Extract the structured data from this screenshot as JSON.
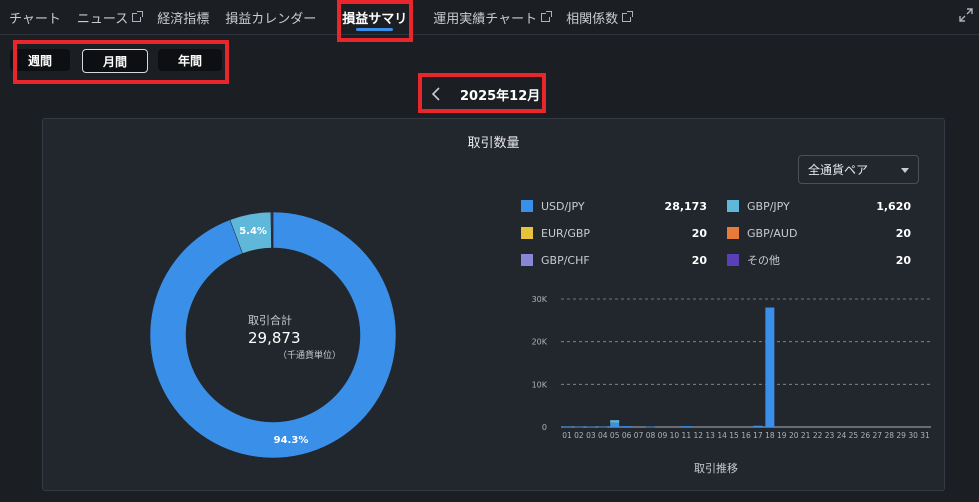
{
  "nav": {
    "tabs": [
      {
        "label": "チャート",
        "external": false
      },
      {
        "label": "ニュース",
        "external": true
      },
      {
        "label": "経済指標",
        "external": false
      },
      {
        "label": "損益カレンダー",
        "external": false
      },
      {
        "label": "損益サマリ",
        "external": false,
        "active": true
      },
      {
        "label": "運用実績チャート",
        "external": true
      },
      {
        "label": "相関係数",
        "external": true
      }
    ]
  },
  "period": {
    "options": [
      "週間",
      "月間",
      "年間"
    ],
    "selected": "月間"
  },
  "month_nav": {
    "label": "2025年12月"
  },
  "panel": {
    "title": "取引数量",
    "pair_select": "全通貨ペア",
    "chart_title": "取引推移"
  },
  "donut": {
    "center_label": "取引合計",
    "center_value": "29,873",
    "center_unit": "（千通貨単位）",
    "labels": [
      "94.3%",
      "5.4%"
    ]
  },
  "legend": [
    {
      "name": "USD/JPY",
      "value": "28,173",
      "color": "#3a8fe8"
    },
    {
      "name": "GBP/JPY",
      "value": "1,620",
      "color": "#5fb8d9"
    },
    {
      "name": "EUR/GBP",
      "value": "20",
      "color": "#e8c23a"
    },
    {
      "name": "GBP/AUD",
      "value": "20",
      "color": "#e87a3a"
    },
    {
      "name": "GBP/CHF",
      "value": "20",
      "color": "#8a86d6"
    },
    {
      "name": "その他",
      "value": "20",
      "color": "#5a3fb8"
    }
  ],
  "chart_data": [
    {
      "type": "pie",
      "categories": [
        "USD/JPY",
        "GBP/JPY",
        "EUR/GBP",
        "GBP/AUD",
        "GBP/CHF",
        "その他"
      ],
      "values": [
        28173,
        1620,
        20,
        20,
        20,
        20
      ],
      "labels": [
        "94.3%",
        "5.4%"
      ]
    },
    {
      "type": "bar",
      "title": "取引推移",
      "categories": [
        "01",
        "02",
        "03",
        "04",
        "05",
        "06",
        "07",
        "08",
        "09",
        "10",
        "11",
        "12",
        "13",
        "14",
        "15",
        "16",
        "17",
        "18",
        "19",
        "20",
        "21",
        "22",
        "23",
        "24",
        "25",
        "26",
        "27",
        "28",
        "29",
        "30",
        "31"
      ],
      "series": [
        {
          "values": [
            150,
            100,
            120,
            80,
            1000,
            200,
            0,
            100,
            0,
            0,
            200,
            0,
            0,
            0,
            0,
            0,
            300,
            28000,
            0,
            0,
            0,
            0,
            0,
            0,
            0,
            0,
            0,
            0,
            0,
            0,
            0
          ]
        },
        {
          "values": [
            0,
            0,
            0,
            0,
            600,
            0,
            0,
            0,
            0,
            0,
            0,
            0,
            0,
            0,
            0,
            0,
            0,
            0,
            0,
            0,
            0,
            0,
            0,
            0,
            0,
            0,
            0,
            0,
            0,
            0,
            0
          ]
        }
      ],
      "yticks": [
        "0",
        "10K",
        "20K",
        "30K"
      ],
      "ylim": [
        0,
        30000
      ],
      "grid": true
    }
  ]
}
